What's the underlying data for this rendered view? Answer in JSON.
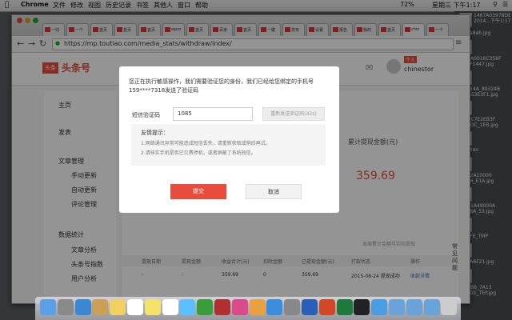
{
  "menubar": {
    "apple": "",
    "app": "Chrome",
    "items": [
      "文件",
      "修改",
      "视图",
      "历史记录",
      "书签",
      "其他人",
      "窗口",
      "帮助"
    ],
    "battery": "72%",
    "clock": "星期三 下午1:17"
  },
  "desktop_files": [
    "1467A03978DB35",
    "2014...下午1:17",
    "8Ebea8eb.jpg",
    "1D68A0016C358F",
    "A8F4F1447.jpg",
    "410614A_893248",
    "F_FFA53E3F1.jpg",
    "ECD4C7E2EB3F",
    "C28ADC_1EB.jpg",
    "Walleton",
    "64C42A10000",
    "3B0A6_E1A.jpg",
    "C64C1A49000A",
    "15478A_53.jpg",
    "1E17FE_TMP",
    "4818A6F21.jpg",
    "31EDB6_7A13",
    "3E23D1_TEP.jpg"
  ],
  "browser": {
    "tabs": [
      "一切",
      "一个",
      "首页",
      "首页",
      "首页",
      "wpro",
      "首页",
      "百家",
      "首页",
      "一键",
      "发布",
      "设置",
      "报告",
      "我的",
      "首页",
      "chin",
      "一个"
    ],
    "url": "https://mp.toutiao.com/media_stats/withdraw/index/"
  },
  "site": {
    "logo_badge": "头条",
    "logo_text": "头条号",
    "user_name": "chinestor",
    "avatar_badge": "个人",
    "sidebar": [
      {
        "label": "主页"
      },
      {
        "label": "发表"
      },
      {
        "label": "文章管理"
      },
      {
        "label": "手动更新"
      },
      {
        "label": "自动更新"
      },
      {
        "label": "评论管理"
      },
      {
        "label": "数据统计"
      },
      {
        "label": "文章分析"
      },
      {
        "label": "头条号指数"
      },
      {
        "label": "用户分析"
      }
    ],
    "accumulated_label": "累计提现金额(元)",
    "accumulated_value": "359.69",
    "note": "本周累计金额可实际提现",
    "table_headers": [
      "提现日期",
      "提现金额",
      "收益合计(元)",
      "扣除金额",
      "已提现金额(元)",
      "打款状态",
      "操作"
    ],
    "table_row": [
      "-",
      "-",
      "359.69",
      "0",
      "359.69",
      "2015-08-24 提现成功",
      "收款详情"
    ],
    "side_tab": "常见问题"
  },
  "modal": {
    "message": "您正在执行敏感操作，我们需要验证您的身份，我们已经给您绑定的手机号159****7318发送了验证码",
    "code_label": "短信验证码",
    "code_value": "1085",
    "resend_label": "重新发送验证码(42s)",
    "tip_title": "友情提示：",
    "tip_line1": "1.网络通讯异常可能造成短信丢失，请重新获取或稍后再试。",
    "tip_line2": "2.请核实手机是否已欠费停机，或者屏蔽了系统短信。",
    "submit_label": "提交",
    "cancel_label": "取消"
  },
  "dock_apps": [
    "finder",
    "launchpad",
    "safari",
    "preview",
    "notes",
    "calendar",
    "stickies",
    "reminders",
    "messages",
    "facetime",
    "photo-booth",
    "itunes",
    "ibooks",
    "app-store",
    "system-preferences",
    "word",
    "powerpoint",
    "excel",
    "qq",
    "chrome",
    "folder",
    "folder",
    "folder",
    "trash"
  ]
}
